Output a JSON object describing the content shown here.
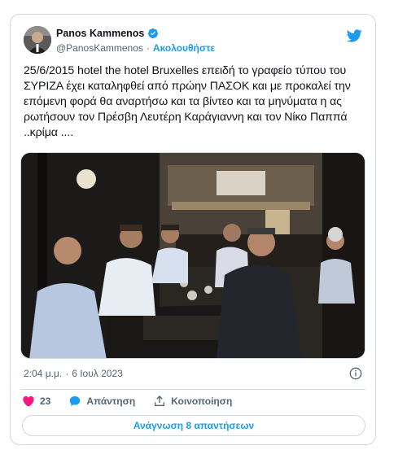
{
  "tweet": {
    "author_name": "Panos Kammenos",
    "author_handle": "@PanosKammenos",
    "separator": "·",
    "follow_label": "Ακολουθήστε",
    "text": "25/6/2015 hotel the hotel Bruxelles επειδή το γραφείο τύπου του ΣΥΡΙΖΑ έχει καταληφθεί από πρώην ΠΑΣΟΚ και με προκαλεί την επόμενη φορά θα αναρτήσω και τα βίντεο και τα μηνύματα η ας ρωτήσουν τον Πρέσβη Λευτέρη Καράγιαννη και τον Νίκο Παππά ..κρίμα ....",
    "time": "2:04 μ.μ.",
    "date": "6 Ιουλ 2023",
    "likes_count": "23",
    "reply_label": "Απάντηση",
    "share_label": "Κοινοποίηση",
    "read_replies_label": "Ανάγνωση 8 απαντήσεων"
  },
  "colors": {
    "accent": "#1d9bf0",
    "like": "#f91880",
    "text": "#0f1419",
    "muted": "#536471",
    "border": "#cfd9de"
  },
  "icons": [
    "verified-badge-icon",
    "twitter-bird-icon",
    "info-icon",
    "heart-icon",
    "reply-bubble-icon",
    "share-icon"
  ]
}
